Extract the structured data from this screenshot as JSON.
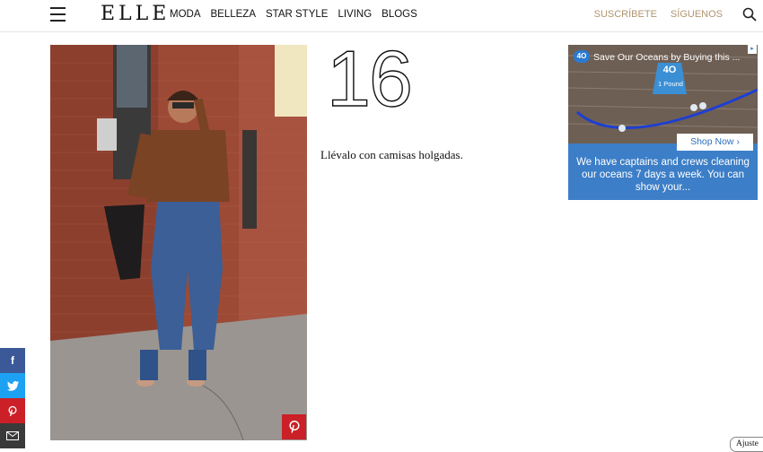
{
  "header": {
    "logo": "ELLE",
    "nav": [
      "MODA",
      "BELLEZA",
      "STAR STYLE",
      "LIVING",
      "BLOGS"
    ],
    "subscribe": "SUSCRÍBETE",
    "follow": "SÍGUENOS",
    "icons": {
      "menu": "hamburger-icon",
      "search": "search-icon"
    }
  },
  "article": {
    "number": "16",
    "caption": "Llévalo con camisas holgadas."
  },
  "ad": {
    "title": "Save Our Oceans by Buying this ...",
    "logo_text": "4O",
    "tag_number": "4O",
    "tag_text": "1 Pound",
    "shop_button": "Shop Now",
    "body": "We have captains and crews cleaning our oceans 7 days a week. You can show your..."
  },
  "share": {
    "facebook": "f",
    "twitter": "twitter-icon",
    "pinterest": "P",
    "email": "email-icon"
  },
  "cookie_tab": "Ajuste",
  "colors": {
    "accent": "#b09570",
    "pinterest": "#cb2027",
    "facebook": "#3b5998",
    "twitter": "#1da1f2",
    "ad_blue": "#3c7ec7"
  }
}
